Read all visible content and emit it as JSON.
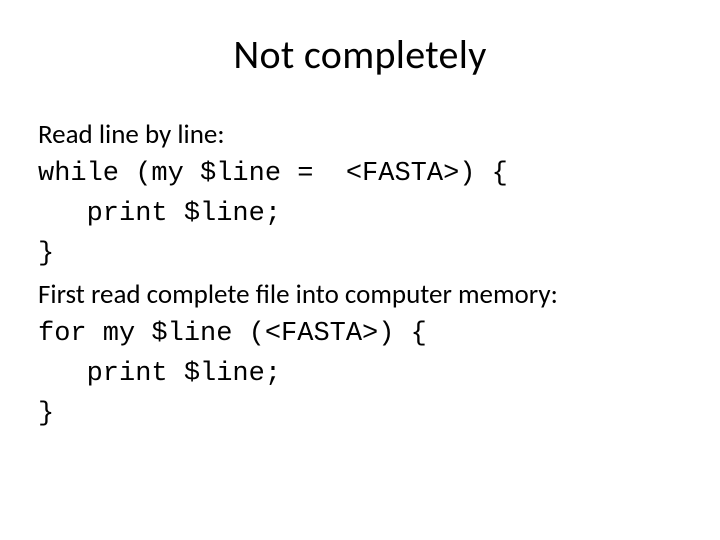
{
  "title": "Not completely",
  "lines": [
    {
      "cls": "sans",
      "text": "Read line by line:"
    },
    {
      "cls": "mono",
      "text": "while (my $line =  <FASTA>) {"
    },
    {
      "cls": "mono",
      "text": "   print $line;"
    },
    {
      "cls": "mono",
      "text": "}"
    },
    {
      "cls": "sans",
      "text": "First read complete file into computer memory:"
    },
    {
      "cls": "mono",
      "text": "for my $line (<FASTA>) {"
    },
    {
      "cls": "mono",
      "text": "   print $line;"
    },
    {
      "cls": "mono",
      "text": "}"
    }
  ]
}
